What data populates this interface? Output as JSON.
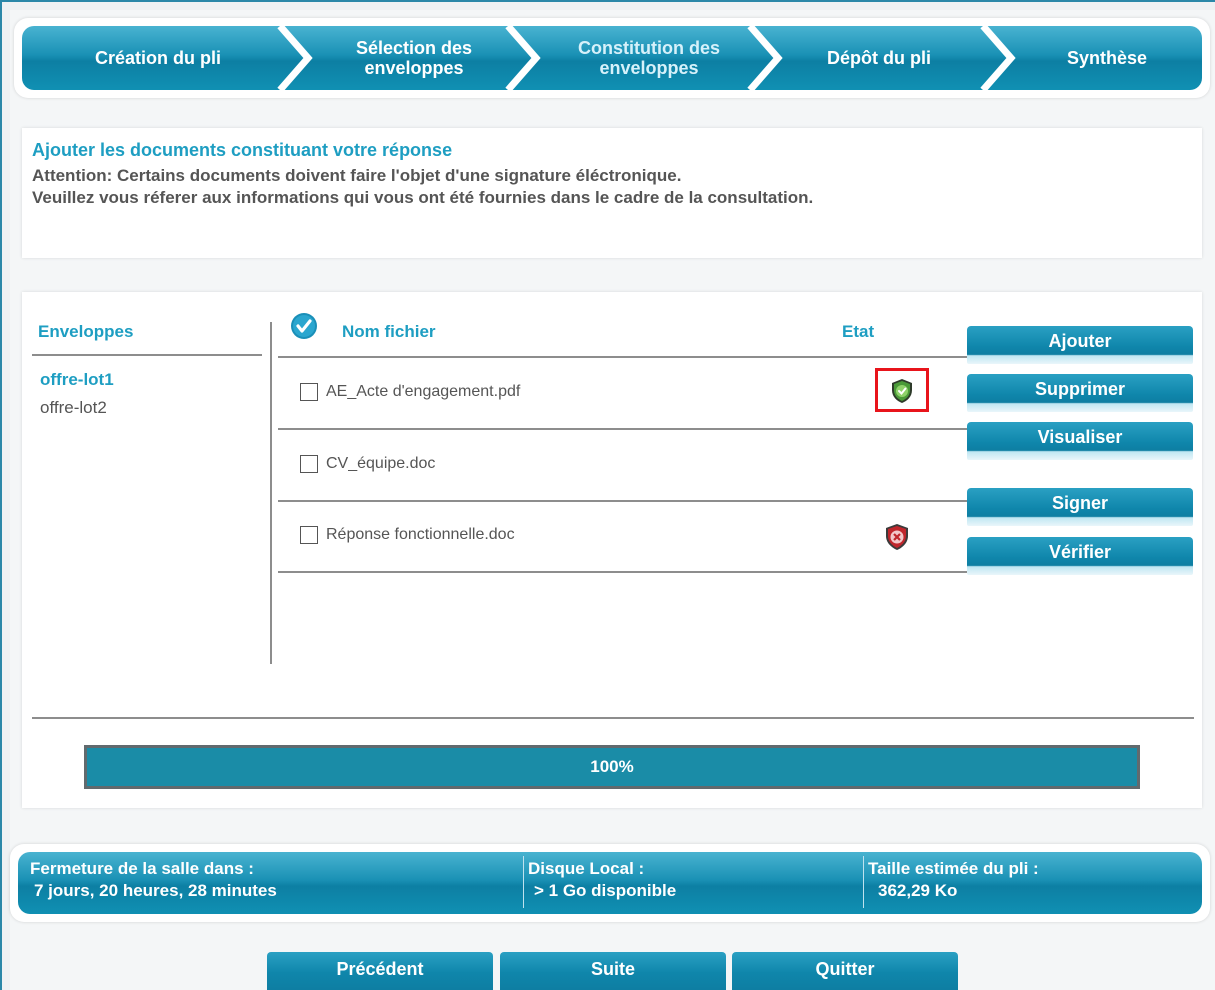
{
  "wizard": {
    "steps": [
      {
        "label": "Création du pli"
      },
      {
        "label": "Sélection des enveloppes"
      },
      {
        "label": "Constitution des enveloppes"
      },
      {
        "label": "Dépôt du pli"
      },
      {
        "label": "Synthèse"
      }
    ],
    "active_step": "Constitution des enveloppes"
  },
  "info": {
    "title": "Ajouter les documents constituant votre réponse",
    "line1": "Attention: Certains documents doivent faire l'objet d'une signature éléctronique.",
    "line2": "Veuillez vous réferer aux informations qui vous ont été fournies dans le cadre de la consultation."
  },
  "envelopes": {
    "header": "Enveloppes",
    "items": [
      {
        "label": "offre-lot1",
        "selected": true
      },
      {
        "label": "offre-lot2",
        "selected": false
      }
    ]
  },
  "files": {
    "header_name": "Nom fichier",
    "header_state": "Etat",
    "rows": [
      {
        "name": "AE_Acte d'engagement.pdf",
        "state": "shield-check-icon"
      },
      {
        "name": "CV_équipe.doc",
        "state": ""
      },
      {
        "name": "Réponse fonctionnelle.doc",
        "state": "shield-cross-icon"
      }
    ]
  },
  "actions": {
    "add": "Ajouter",
    "delete": "Supprimer",
    "view": "Visualiser",
    "sign": "Signer",
    "verify": "Vérifier"
  },
  "progress": {
    "label": "100%",
    "value": 1.0
  },
  "status": {
    "closing_label": "Fermeture de la salle dans :",
    "closing_value": "7 jours, 20 heures, 28 minutes",
    "disk_label": "Disque Local :",
    "disk_value": "> 1 Go disponible",
    "size_label": "Taille estimée du pli :",
    "size_value": "362,29 Ko"
  },
  "nav": {
    "previous": "Précédent",
    "next": "Suite",
    "quit": "Quitter"
  },
  "colors": {
    "accent": "#1e9ec2",
    "highlight": "#e8141b",
    "ok": "#3c8c2e",
    "error": "#c0262c"
  }
}
